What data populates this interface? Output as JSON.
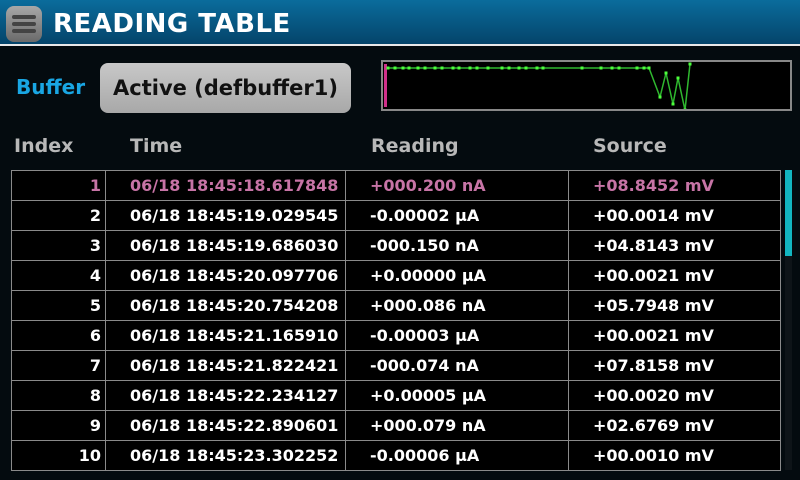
{
  "header": {
    "title": "READING TABLE",
    "menu_icon": "hamburger-menu-icon"
  },
  "buffer": {
    "label": "Buffer",
    "selected": "Active (defbuffer1)"
  },
  "colors": {
    "accent": "#19a6e3",
    "selected_row": "#c774a6",
    "trace": "#2fc02f",
    "scroll": "#12b5c0"
  },
  "columns": [
    "Index",
    "Time",
    "Reading",
    "Source"
  ],
  "rows": [
    {
      "index": "1",
      "time": "06/18 18:45:18.617848",
      "reading": "+000.200 nA",
      "source": "+08.8452 mV"
    },
    {
      "index": "2",
      "time": "06/18 18:45:19.029545",
      "reading": "-0.00002 μA",
      "source": "+00.0014 mV"
    },
    {
      "index": "3",
      "time": "06/18 18:45:19.686030",
      "reading": "-000.150 nA",
      "source": "+04.8143 mV"
    },
    {
      "index": "4",
      "time": "06/18 18:45:20.097706",
      "reading": "+0.00000 μA",
      "source": "+00.0021 mV"
    },
    {
      "index": "5",
      "time": "06/18 18:45:20.754208",
      "reading": "+000.086 nA",
      "source": "+05.7948 mV"
    },
    {
      "index": "6",
      "time": "06/18 18:45:21.165910",
      "reading": "-0.00003 μA",
      "source": "+00.0021 mV"
    },
    {
      "index": "7",
      "time": "06/18 18:45:21.822421",
      "reading": "-000.074 nA",
      "source": "+07.8158 mV"
    },
    {
      "index": "8",
      "time": "06/18 18:45:22.234127",
      "reading": "+0.00005 μA",
      "source": "+00.0020 mV"
    },
    {
      "index": "9",
      "time": "06/18 18:45:22.890601",
      "reading": "+000.079 nA",
      "source": "+02.6769 mV"
    },
    {
      "index": "10",
      "time": "06/18 18:45:23.302252",
      "reading": "-0.00006 μA",
      "source": "+00.0010 mV"
    }
  ]
}
